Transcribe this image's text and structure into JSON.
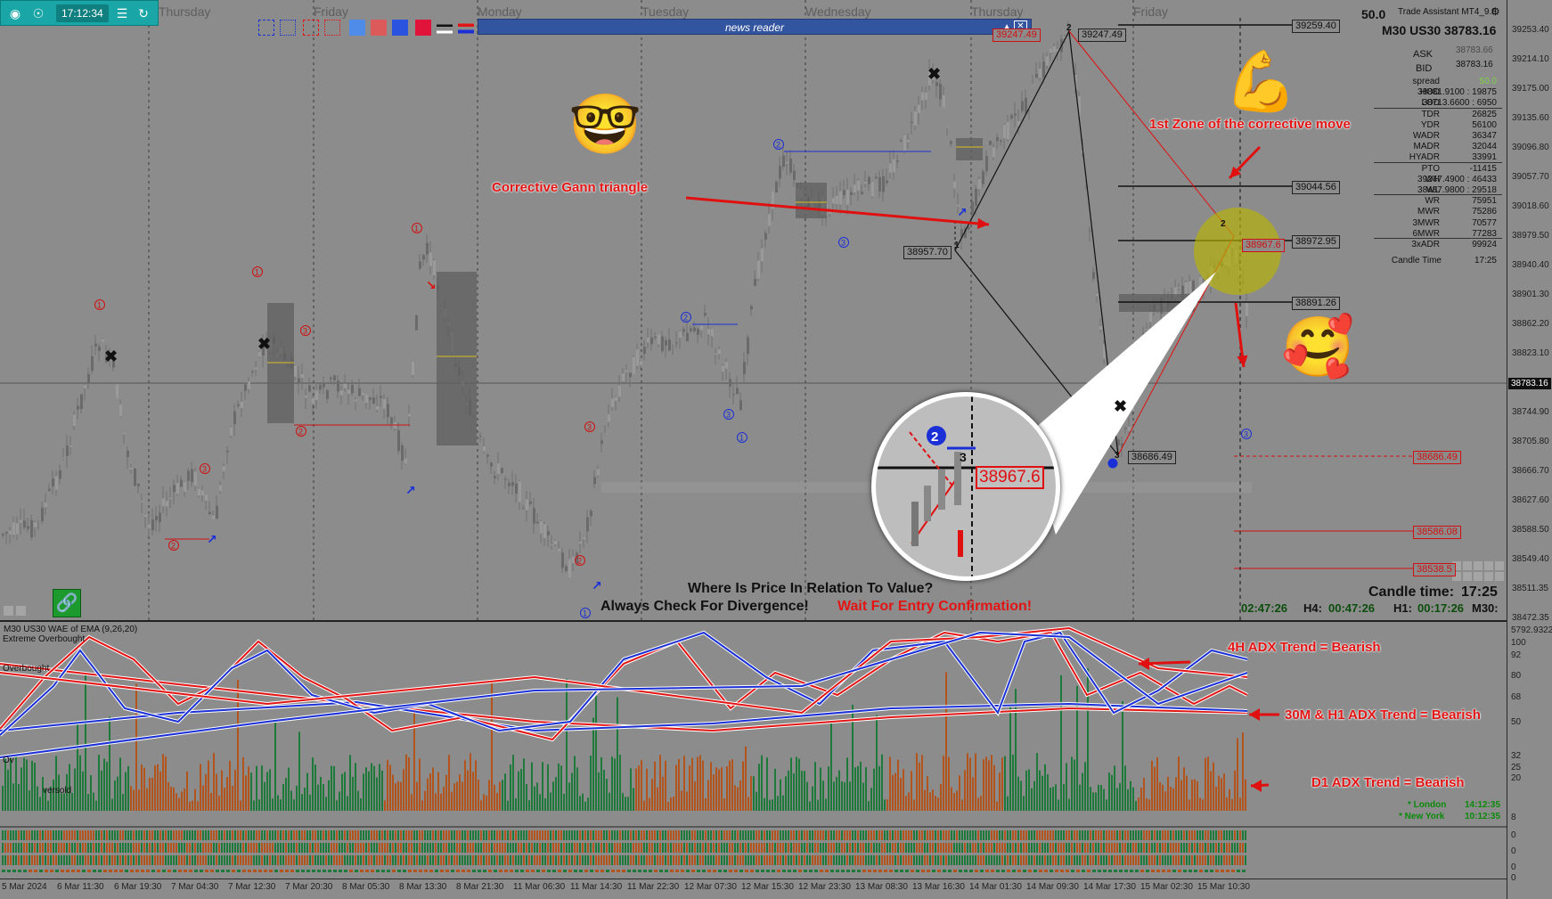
{
  "toolbar": {
    "time": "17:12:34"
  },
  "news_reader": {
    "title": "news reader"
  },
  "days": [
    "Thursday",
    "Friday",
    "Monday",
    "Tuesday",
    "Wednesday",
    "Thursday",
    "Friday"
  ],
  "header": {
    "spread_value": "50.0",
    "trade_assistant": "Trade Assistant MT4_9.8",
    "symbol_title": "M30 US30 38783.16",
    "ask_label": "ASK",
    "ask_value": "38783.66",
    "bid_label": "BID",
    "bid_value": "38783.16"
  },
  "stats": [
    {
      "label": "spread",
      "value": "50.0"
    },
    {
      "label": "HOD",
      "value": "38881.9100 : 19875"
    },
    {
      "label": "LOD",
      "value": "38713.6600 : 6950"
    },
    {
      "label": "TDR",
      "value": "26825"
    },
    {
      "label": "YDR",
      "value": "56100"
    },
    {
      "label": "WADR",
      "value": "36347"
    },
    {
      "label": "MADR",
      "value": "32044"
    },
    {
      "label": "HYADR",
      "value": "33991"
    },
    {
      "label": "PTO",
      "value": "-11415"
    },
    {
      "label": "WH",
      "value": "39247.4900 : 46433"
    },
    {
      "label": "WL",
      "value": "38487.9800 : 29518"
    },
    {
      "label": "WR",
      "value": "75951"
    },
    {
      "label": "MWR",
      "value": "75286"
    },
    {
      "label": "3MWR",
      "value": "70577"
    },
    {
      "label": "6MWR",
      "value": "77283"
    },
    {
      "label": "3xADR",
      "value": "99924"
    },
    {
      "label": "Candle Time",
      "value": "17:25"
    }
  ],
  "price_axis": [
    "39253.40",
    "39214.10",
    "39175.00",
    "39135.60",
    "39096.80",
    "39057.70",
    "39018.60",
    "38979.50",
    "38940.40",
    "38901.30",
    "38862.20",
    "38823.10",
    "38783.16",
    "38744.90",
    "38705.80",
    "38666.70",
    "38627.60",
    "38588.50",
    "38549.40",
    "38511.35",
    "38472.35"
  ],
  "sub_axis": [
    "5792.9322",
    "100",
    "92",
    "80",
    "68",
    "50",
    "32",
    "25",
    "20",
    "8",
    "0",
    "0",
    "0",
    "0"
  ],
  "levels": {
    "l1": "39259.40",
    "l2": "39044.56",
    "l3": "38972.95",
    "l4": "38891.26",
    "r1": "38686.49",
    "r2": "38586.08",
    "r3": "38538.5"
  },
  "pattern": {
    "p1": "38957.70",
    "p2": "39247.49",
    "p2b": "39247.49",
    "p3": "38686.49",
    "target": "38967.6",
    "mag_value": "38967.6"
  },
  "annotations": {
    "gann": "Corrective Gann triangle",
    "zone": "1st Zone of the corrective move",
    "value_q": "Where Is Price In Relation To Value?",
    "divergence": "Always Check For Divergence!",
    "confirmation": "Wait For Entry Confirmation!",
    "adx_4h": "4H ADX Trend = Bearish",
    "adx_30m": "30M & H1 ADX Trend = Bearish",
    "adx_d1": "D1 ADX Trend = Bearish"
  },
  "candle_time": {
    "label": "Candle time:",
    "value": "17:25"
  },
  "timers": {
    "t1": "02:47:26",
    "h4_label": "H4:",
    "h4": "00:47:26",
    "h1_label": "H1:",
    "h1": "00:17:26",
    "m30_label": "M30:"
  },
  "indicator": {
    "title": "M30 US30 WAE of EMA (9,26,20)",
    "extreme_overbought": "Extreme Overbought",
    "overbought": "Overbought",
    "oversold": "versold",
    "ov": "Ov"
  },
  "sessions": {
    "london_label": "* London",
    "london_time": "14:12:35",
    "newyork_label": "* New York",
    "newyork_time": "10:12:35"
  },
  "x_axis": [
    "5 Mar 2024",
    "6 Mar 11:30",
    "6 Mar 19:30",
    "7 Mar 04:30",
    "7 Mar 12:30",
    "7 Mar 20:30",
    "8 Mar 05:30",
    "8 Mar 13:30",
    "8 Mar 21:30",
    "11 Mar 06:30",
    "11 Mar 14:30",
    "11 Mar 22:30",
    "12 Mar 07:30",
    "12 Mar 15:30",
    "12 Mar 23:30",
    "13 Mar 08:30",
    "13 Mar 16:30",
    "14 Mar 01:30",
    "14 Mar 09:30",
    "14 Mar 17:30",
    "15 Mar 02:30",
    "15 Mar 10:30"
  ],
  "colors": {
    "bull": "#1e7a3a",
    "bear": "#b2541c",
    "adx_red": "#e31414",
    "adx_blue": "#1a2fd6",
    "chart_bg": "#8c8c8c"
  }
}
